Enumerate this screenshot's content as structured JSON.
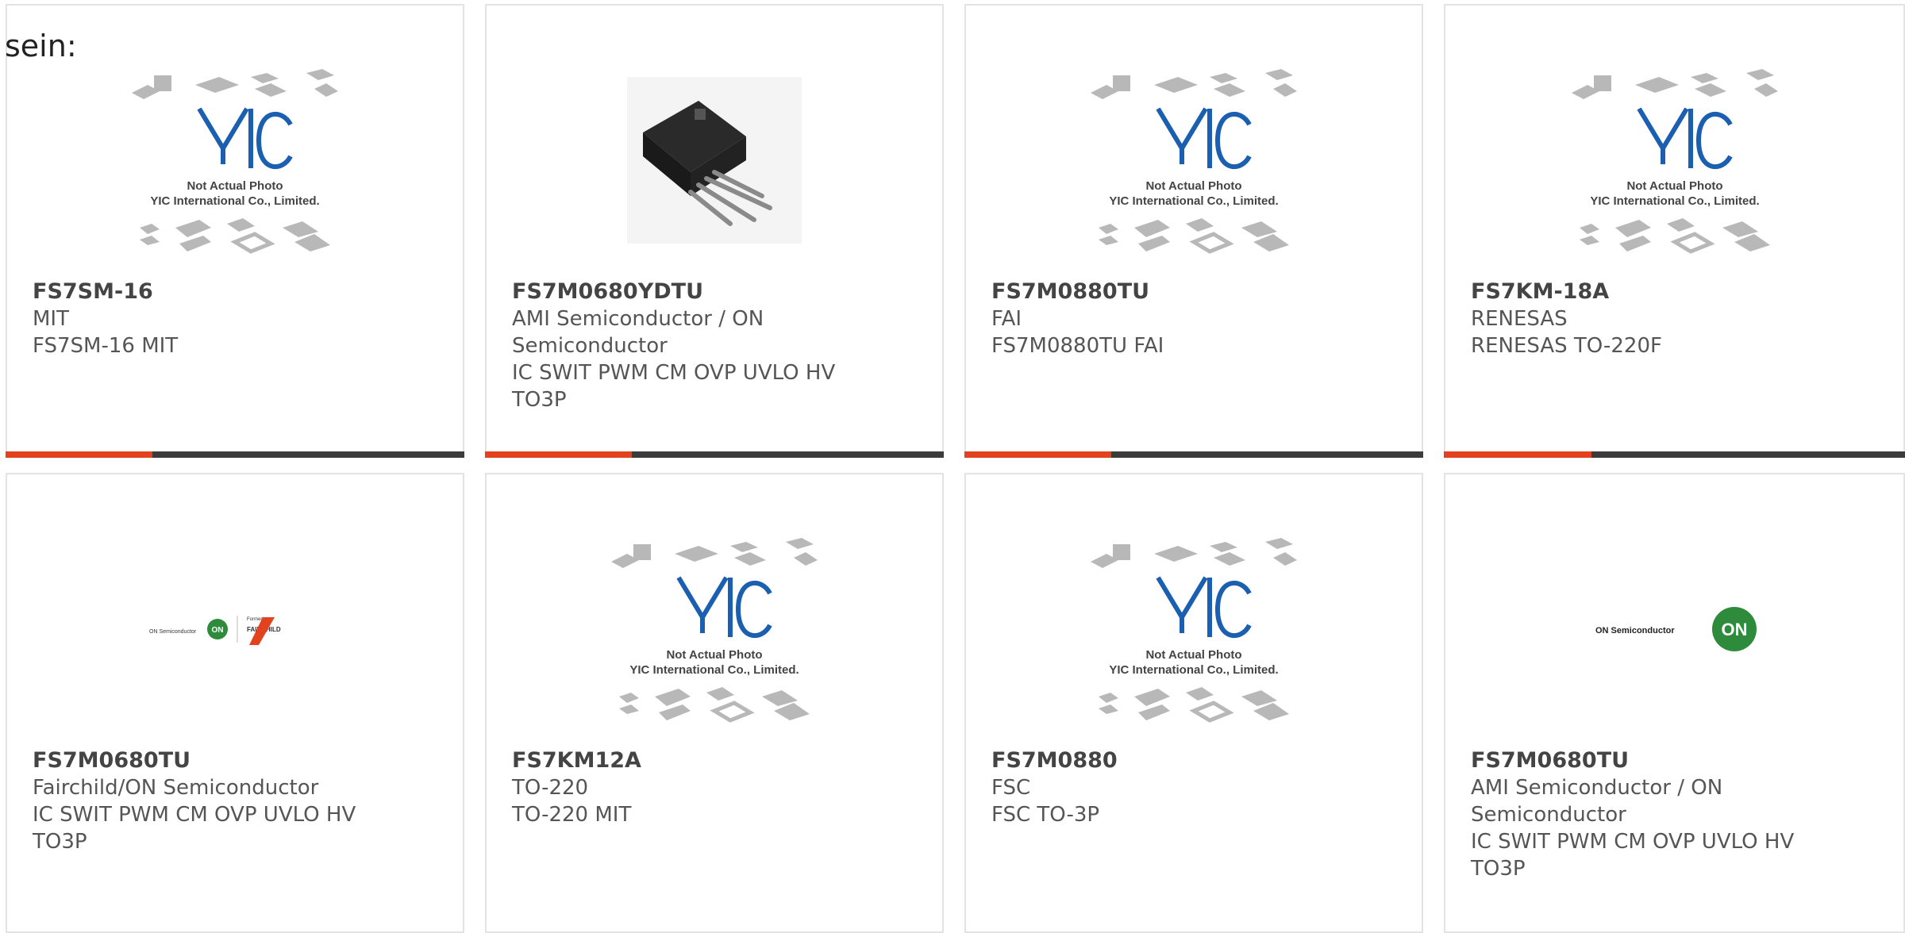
{
  "lead_text": "sein:",
  "accent_color": "#e2431e",
  "bar_color": "#3c3c3c",
  "placeholder": {
    "caption_line1": "Not Actual Photo",
    "caption_line2": "YIC International Co., Limited.",
    "logo_text": "YIC"
  },
  "cards": [
    {
      "part": "FS7SM-16",
      "lines": [
        "MIT",
        "FS7SM-16 MIT"
      ],
      "image": "yic-placeholder"
    },
    {
      "part": "FS7M0680YDTU",
      "lines": [
        "AMI Semiconductor / ON",
        "Semiconductor",
        "IC SWIT PWM CM OVP UVLO HV",
        "TO3P"
      ],
      "image": "to3p-package-photo"
    },
    {
      "part": "FS7M0880TU",
      "lines": [
        "FAI",
        "FS7M0880TU FAI"
      ],
      "image": "yic-placeholder"
    },
    {
      "part": "FS7KM-18A",
      "lines": [
        "RENESAS",
        "RENESAS TO-220F"
      ],
      "image": "yic-placeholder"
    },
    {
      "part": "FS7M0680TU",
      "lines": [
        "Fairchild/ON Semiconductor",
        "IC SWIT PWM CM OVP UVLO HV",
        "TO3P"
      ],
      "image": "on-fairchild-logo"
    },
    {
      "part": "FS7KM12A",
      "lines": [
        "TO-220",
        "TO-220 MIT"
      ],
      "image": "yic-placeholder"
    },
    {
      "part": "FS7M0880",
      "lines": [
        "FSC",
        "FSC TO-3P"
      ],
      "image": "yic-placeholder"
    },
    {
      "part": "FS7M0680TU",
      "lines": [
        "AMI Semiconductor / ON",
        "Semiconductor",
        "IC SWIT PWM CM OVP UVLO HV",
        "TO3P"
      ],
      "image": "on-semiconductor-logo"
    }
  ],
  "logos": {
    "on_semi_small": "ON Semiconductor",
    "on_badge": "ON",
    "formerly": "Formerly",
    "fairchild": "FAIRCHILD"
  }
}
